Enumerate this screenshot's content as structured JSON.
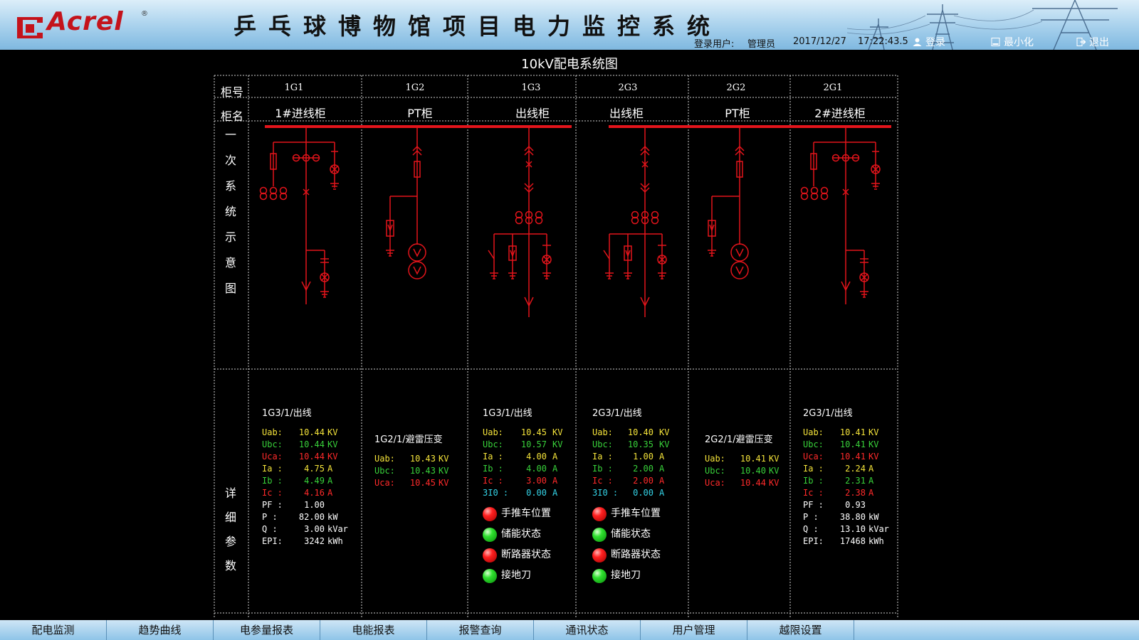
{
  "header": {
    "logo_text": "Acrel",
    "logo_reg": "®",
    "title": "乒乓球博物馆项目电力监控系统",
    "user_label": "登录用户:",
    "user_name": "管理员",
    "date": "2017/12/27",
    "time": "17:22:43.5",
    "login_label": "登录",
    "minimize_label": "最小化",
    "exit_label": "退出"
  },
  "diagram_title": "10kV配电系统图",
  "labels": {
    "cab_no": "柜号",
    "cab_name": "柜名",
    "primary_chars": [
      "一",
      "次",
      "系",
      "统",
      "示",
      "意",
      "图"
    ],
    "detail_chars": [
      "详",
      "细",
      "参",
      "数"
    ]
  },
  "cabinets": [
    {
      "no": "1G1",
      "name": "1#进线柜"
    },
    {
      "no": "1G2",
      "name": "PT柜"
    },
    {
      "no": "1G3",
      "name": "出线柜"
    },
    {
      "no": "2G3",
      "name": "出线柜"
    },
    {
      "no": "2G2",
      "name": "PT柜"
    },
    {
      "no": "2G1",
      "name": "2#进线柜"
    }
  ],
  "panels": {
    "p1": {
      "title": "1G3/1/出线",
      "rows": [
        {
          "label": "Uab:",
          "value": "10.44",
          "unit": "KV",
          "color": "y"
        },
        {
          "label": "Ubc:",
          "value": "10.44",
          "unit": "KV",
          "color": "g"
        },
        {
          "label": "Uca:",
          "value": "10.44",
          "unit": "KV",
          "color": "r"
        },
        {
          "label": "Ia :",
          "value": "4.75",
          "unit": "A",
          "color": "y"
        },
        {
          "label": "Ib :",
          "value": "4.49",
          "unit": "A",
          "color": "g"
        },
        {
          "label": "Ic :",
          "value": "4.16",
          "unit": "A",
          "color": "r"
        },
        {
          "label": "PF :",
          "value": "1.00",
          "unit": "",
          "color": "w"
        },
        {
          "label": "P  :",
          "value": "82.00",
          "unit": "kW",
          "color": "w"
        },
        {
          "label": "Q  :",
          "value": "3.00",
          "unit": "kVar",
          "color": "w"
        },
        {
          "label": "EPI:",
          "value": "3242",
          "unit": "kWh",
          "color": "w"
        }
      ]
    },
    "p2": {
      "title": "1G2/1/避雷压变",
      "rows": [
        {
          "label": "Uab:",
          "value": "10.43",
          "unit": "KV",
          "color": "y"
        },
        {
          "label": "Ubc:",
          "value": "10.43",
          "unit": "KV",
          "color": "g"
        },
        {
          "label": "Uca:",
          "value": "10.45",
          "unit": "KV",
          "color": "r"
        }
      ]
    },
    "p3": {
      "title": "1G3/1/出线",
      "rows": [
        {
          "label": "Uab:",
          "value": "10.45",
          "unit": "KV",
          "color": "y"
        },
        {
          "label": "Ubc:",
          "value": "10.57",
          "unit": "KV",
          "color": "g"
        },
        {
          "label": "Ia :",
          "value": "4.00",
          "unit": "A",
          "color": "y"
        },
        {
          "label": "Ib :",
          "value": "4.00",
          "unit": "A",
          "color": "g"
        },
        {
          "label": "Ic :",
          "value": "3.00",
          "unit": "A",
          "color": "r"
        },
        {
          "label": "3I0 :",
          "value": "0.00",
          "unit": "A",
          "color": "c"
        }
      ],
      "status": [
        {
          "label": "手推车位置",
          "state": "red"
        },
        {
          "label": "储能状态",
          "state": "green"
        },
        {
          "label": "断路器状态",
          "state": "red"
        },
        {
          "label": "接地刀",
          "state": "green"
        }
      ]
    },
    "p4": {
      "title": "2G3/1/出线",
      "rows": [
        {
          "label": "Uab:",
          "value": "10.40",
          "unit": "KV",
          "color": "y"
        },
        {
          "label": "Ubc:",
          "value": "10.35",
          "unit": "KV",
          "color": "g"
        },
        {
          "label": "Ia :",
          "value": "1.00",
          "unit": "A",
          "color": "y"
        },
        {
          "label": "Ib :",
          "value": "2.00",
          "unit": "A",
          "color": "g"
        },
        {
          "label": "Ic :",
          "value": "2.00",
          "unit": "A",
          "color": "r"
        },
        {
          "label": "3I0 :",
          "value": "0.00",
          "unit": "A",
          "color": "c"
        }
      ],
      "status": [
        {
          "label": "手推车位置",
          "state": "red"
        },
        {
          "label": "储能状态",
          "state": "green"
        },
        {
          "label": "断路器状态",
          "state": "red"
        },
        {
          "label": "接地刀",
          "state": "green"
        }
      ]
    },
    "p5": {
      "title": "2G2/1/避雷压变",
      "rows": [
        {
          "label": "Uab:",
          "value": "10.41",
          "unit": "KV",
          "color": "y"
        },
        {
          "label": "Ubc:",
          "value": "10.40",
          "unit": "KV",
          "color": "g"
        },
        {
          "label": "Uca:",
          "value": "10.44",
          "unit": "KV",
          "color": "r"
        }
      ]
    },
    "p6": {
      "title": "2G3/1/出线",
      "rows": [
        {
          "label": "Uab:",
          "value": "10.41",
          "unit": "KV",
          "color": "y"
        },
        {
          "label": "Ubc:",
          "value": "10.41",
          "unit": "KV",
          "color": "g"
        },
        {
          "label": "Uca:",
          "value": "10.41",
          "unit": "KV",
          "color": "r"
        },
        {
          "label": "Ia :",
          "value": "2.24",
          "unit": "A",
          "color": "y"
        },
        {
          "label": "Ib :",
          "value": "2.31",
          "unit": "A",
          "color": "g"
        },
        {
          "label": "Ic :",
          "value": "2.38",
          "unit": "A",
          "color": "r"
        },
        {
          "label": "PF :",
          "value": "0.93",
          "unit": "",
          "color": "w"
        },
        {
          "label": "P  :",
          "value": "38.80",
          "unit": "kW",
          "color": "w"
        },
        {
          "label": "Q  :",
          "value": "13.10",
          "unit": "kVar",
          "color": "w"
        },
        {
          "label": "EPI:",
          "value": "17468",
          "unit": "kWh",
          "color": "w"
        }
      ]
    }
  },
  "footer_tabs": [
    "配电监测",
    "趋势曲线",
    "电参量报表",
    "电能报表",
    "报警查询",
    "通讯状态",
    "用户管理",
    "越限设置"
  ],
  "colors": {
    "busbar": "#e3141b",
    "grid_line": "#cfcfcf",
    "header_blue": "#a6d0ec"
  }
}
